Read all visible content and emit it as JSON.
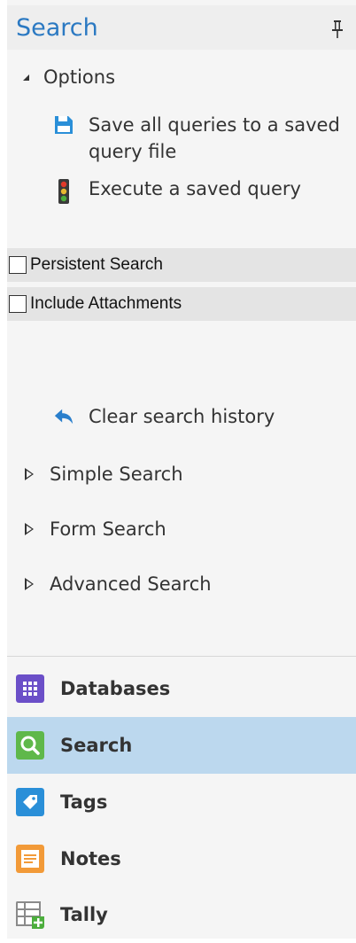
{
  "panel": {
    "title": "Search",
    "pin_icon": "pin-icon"
  },
  "options": {
    "label": "Options",
    "items": [
      {
        "label": "Save all queries to a saved",
        "label2": "query file",
        "icon": "save-query-icon"
      },
      {
        "label": "Execute a saved query",
        "icon": "traffic-light-icon"
      }
    ]
  },
  "checkboxes": [
    {
      "label": "Persistent Search",
      "checked": false
    },
    {
      "label": "Include Attachments",
      "checked": false
    }
  ],
  "clear_history": {
    "label": "Clear search history",
    "icon": "undo-arrow-icon"
  },
  "sections": [
    {
      "label": "Simple Search"
    },
    {
      "label": "Form Search"
    },
    {
      "label": "Advanced Search"
    }
  ],
  "nav": [
    {
      "label": "Databases",
      "icon": "databases-icon",
      "color": "#6b4fc8",
      "active": false
    },
    {
      "label": "Search",
      "icon": "search-icon",
      "color": "#5fb84a",
      "active": true
    },
    {
      "label": "Tags",
      "icon": "tag-icon",
      "color": "#2a8fd8",
      "active": false
    },
    {
      "label": "Notes",
      "icon": "notes-icon",
      "color": "#f29a38",
      "active": false
    },
    {
      "label": "Tally",
      "icon": "tally-icon",
      "color": "#8a8a8a",
      "active": false
    }
  ]
}
